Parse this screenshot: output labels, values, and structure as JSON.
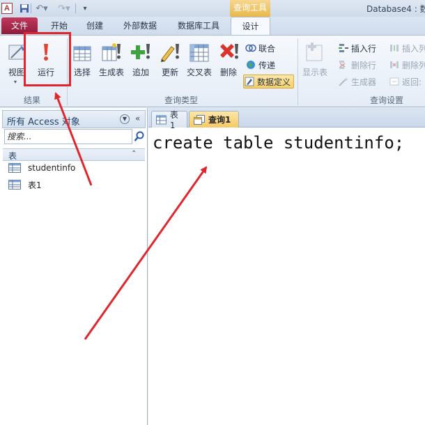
{
  "window": {
    "app_logo": "A",
    "title": "Database4 : 数",
    "context_tab_header": "查询工具"
  },
  "qat": {
    "icons": [
      "save-icon",
      "undo-icon",
      "redo-icon",
      "qat-more-icon"
    ]
  },
  "tabs": {
    "file": "文件",
    "home": "开始",
    "create": "创建",
    "external": "外部数据",
    "dbtools": "数据库工具",
    "design": "设计"
  },
  "ribbon": {
    "results_group": {
      "label": "结果",
      "view": "视图",
      "run": "运行"
    },
    "query_type_group": {
      "label": "查询类型",
      "select": "选择",
      "make_table": "生成表",
      "append": "追加",
      "update": "更新",
      "crosstab": "交叉表",
      "delete": "删除",
      "union": "联合",
      "pass_through": "传递",
      "data_definition": "数据定义"
    },
    "query_setup_group": {
      "label": "查询设置",
      "show_table": "显示表",
      "insert_rows": "插入行",
      "delete_rows": "删除行",
      "builder": "生成器",
      "insert_columns": "插入列",
      "delete_columns": "删除列",
      "return": "返回:"
    }
  },
  "nav": {
    "title": "所有 Access 对象",
    "search_placeholder": "搜索...",
    "group_title": "表",
    "items": [
      {
        "label": "studentinfo"
      },
      {
        "label": "表1"
      }
    ]
  },
  "documents": {
    "tabs": [
      {
        "label": "表1"
      },
      {
        "label": "查询1"
      }
    ],
    "sql_text": "create table studentinfo;"
  },
  "colors": {
    "file_tab": "#a8294b",
    "context_accent": "#e8b84c",
    "annotation_red": "#e0262c"
  }
}
